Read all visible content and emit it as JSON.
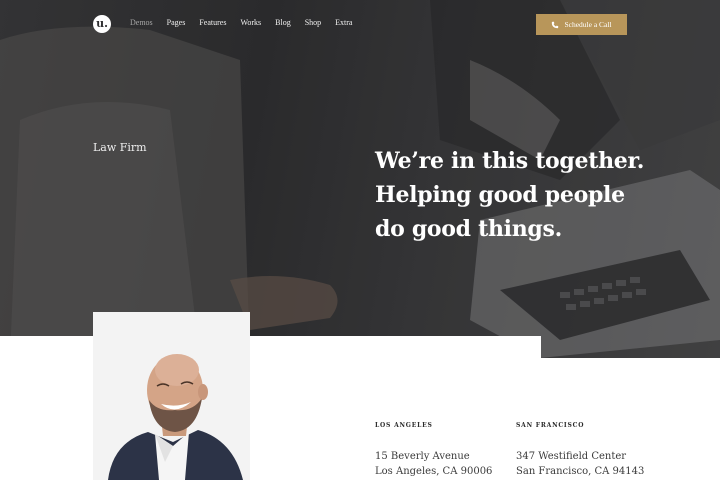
{
  "nav": {
    "logo_letter": "u.",
    "items": [
      "Demos",
      "Pages",
      "Features",
      "Works",
      "Blog",
      "Shop",
      "Extra"
    ],
    "active": "Demos",
    "cta_label": "Schedule a Call"
  },
  "hero": {
    "eyebrow": "Law Firm",
    "headline_lines": [
      "We’re in this together.",
      "Helping good people",
      "do good things."
    ]
  },
  "offices": [
    {
      "city": "LOS ANGELES",
      "street": "15 Beverly Avenue",
      "locality": "Los Angeles, CA 90006"
    },
    {
      "city": "SAN FRANCISCO",
      "street": "347 Westifield Center",
      "locality": "San Francisco, CA 94143"
    }
  ],
  "colors": {
    "accent": "#b8965a",
    "hero_dark": "#333335",
    "text_light": "#ffffff"
  }
}
